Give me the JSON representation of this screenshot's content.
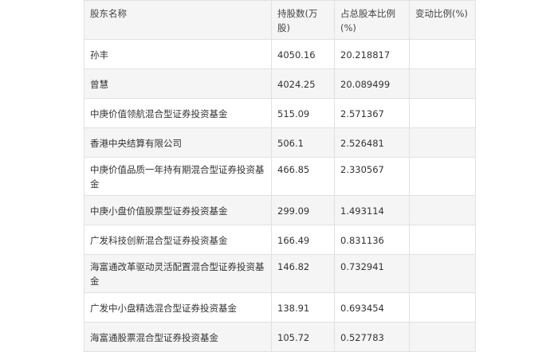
{
  "table": {
    "headers": [
      "股东名称",
      "持股数(万股)",
      "占总股本比例(%)",
      "变动比例(%)"
    ],
    "rows": [
      [
        "孙丰",
        "4050.16",
        "20.218817",
        ""
      ],
      [
        "曾慧",
        "4024.25",
        "20.089499",
        ""
      ],
      [
        "中庚价值领航混合型证券投资基金",
        "515.09",
        "2.571367",
        ""
      ],
      [
        "香港中央结算有限公司",
        "506.1",
        "2.526481",
        ""
      ],
      [
        "中庚价值品质一年持有期混合型证券投资基金",
        "466.85",
        "2.330567",
        ""
      ],
      [
        "中庚小盘价值股票型证券投资基金",
        "299.09",
        "1.493114",
        ""
      ],
      [
        "广发科技创新混合型证券投资基金",
        "166.49",
        "0.831136",
        ""
      ],
      [
        "海富通改革驱动灵活配置混合型证券投资基金",
        "146.82",
        "0.732941",
        ""
      ],
      [
        "广发中小盘精选混合型证券投资基金",
        "138.91",
        "0.693454",
        ""
      ],
      [
        "海富通股票混合型证券投资基金",
        "105.72",
        "0.527783",
        ""
      ]
    ]
  },
  "colors": {
    "header_bg": "#f5f5f5",
    "alt_row_bg": "#f5f5f5",
    "border": "#e1e1e1",
    "text": "#333333"
  }
}
